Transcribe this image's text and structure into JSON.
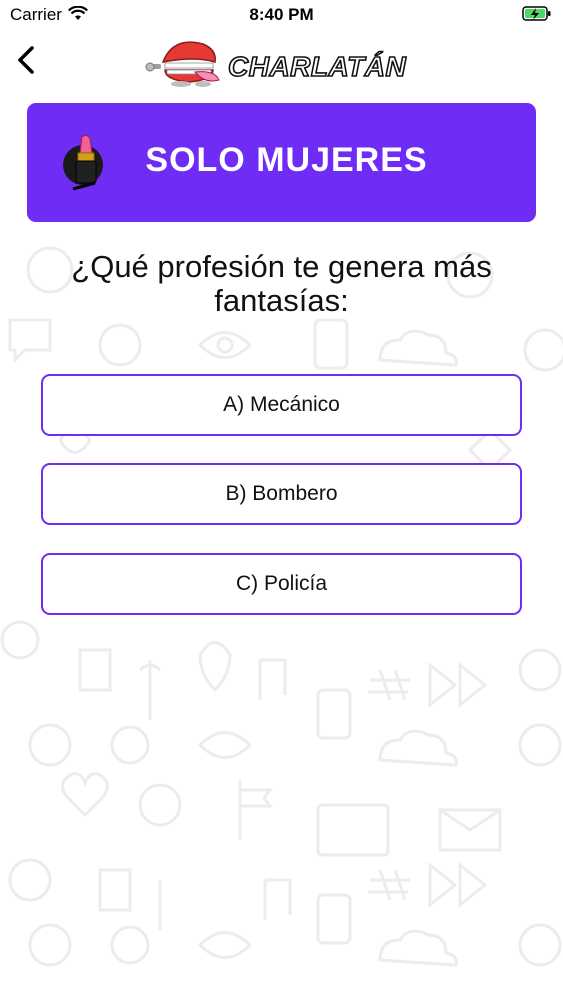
{
  "status_bar": {
    "carrier": "Carrier",
    "time": "8:40 PM",
    "icons": [
      "wifi-icon",
      "battery-charging-icon"
    ]
  },
  "nav": {
    "back_icon": "chevron-left-icon",
    "logo_text": "CHARLATÁN",
    "logo_icon": "wind-up-chattering-teeth-icon"
  },
  "category": {
    "title": "SOLO MUJERES",
    "icon": "lipstick-icon",
    "color": "#6f2cf4"
  },
  "question": {
    "text": "¿Qué profesión te genera más fantasías:"
  },
  "answers": [
    {
      "label": "A) Mecánico"
    },
    {
      "label": "B) Bombero"
    },
    {
      "label": "C) Policía"
    }
  ],
  "colors": {
    "accent": "#6f2cf4",
    "background": "#ffffff",
    "battery": "#4cd964",
    "logo_red": "#e53935"
  }
}
